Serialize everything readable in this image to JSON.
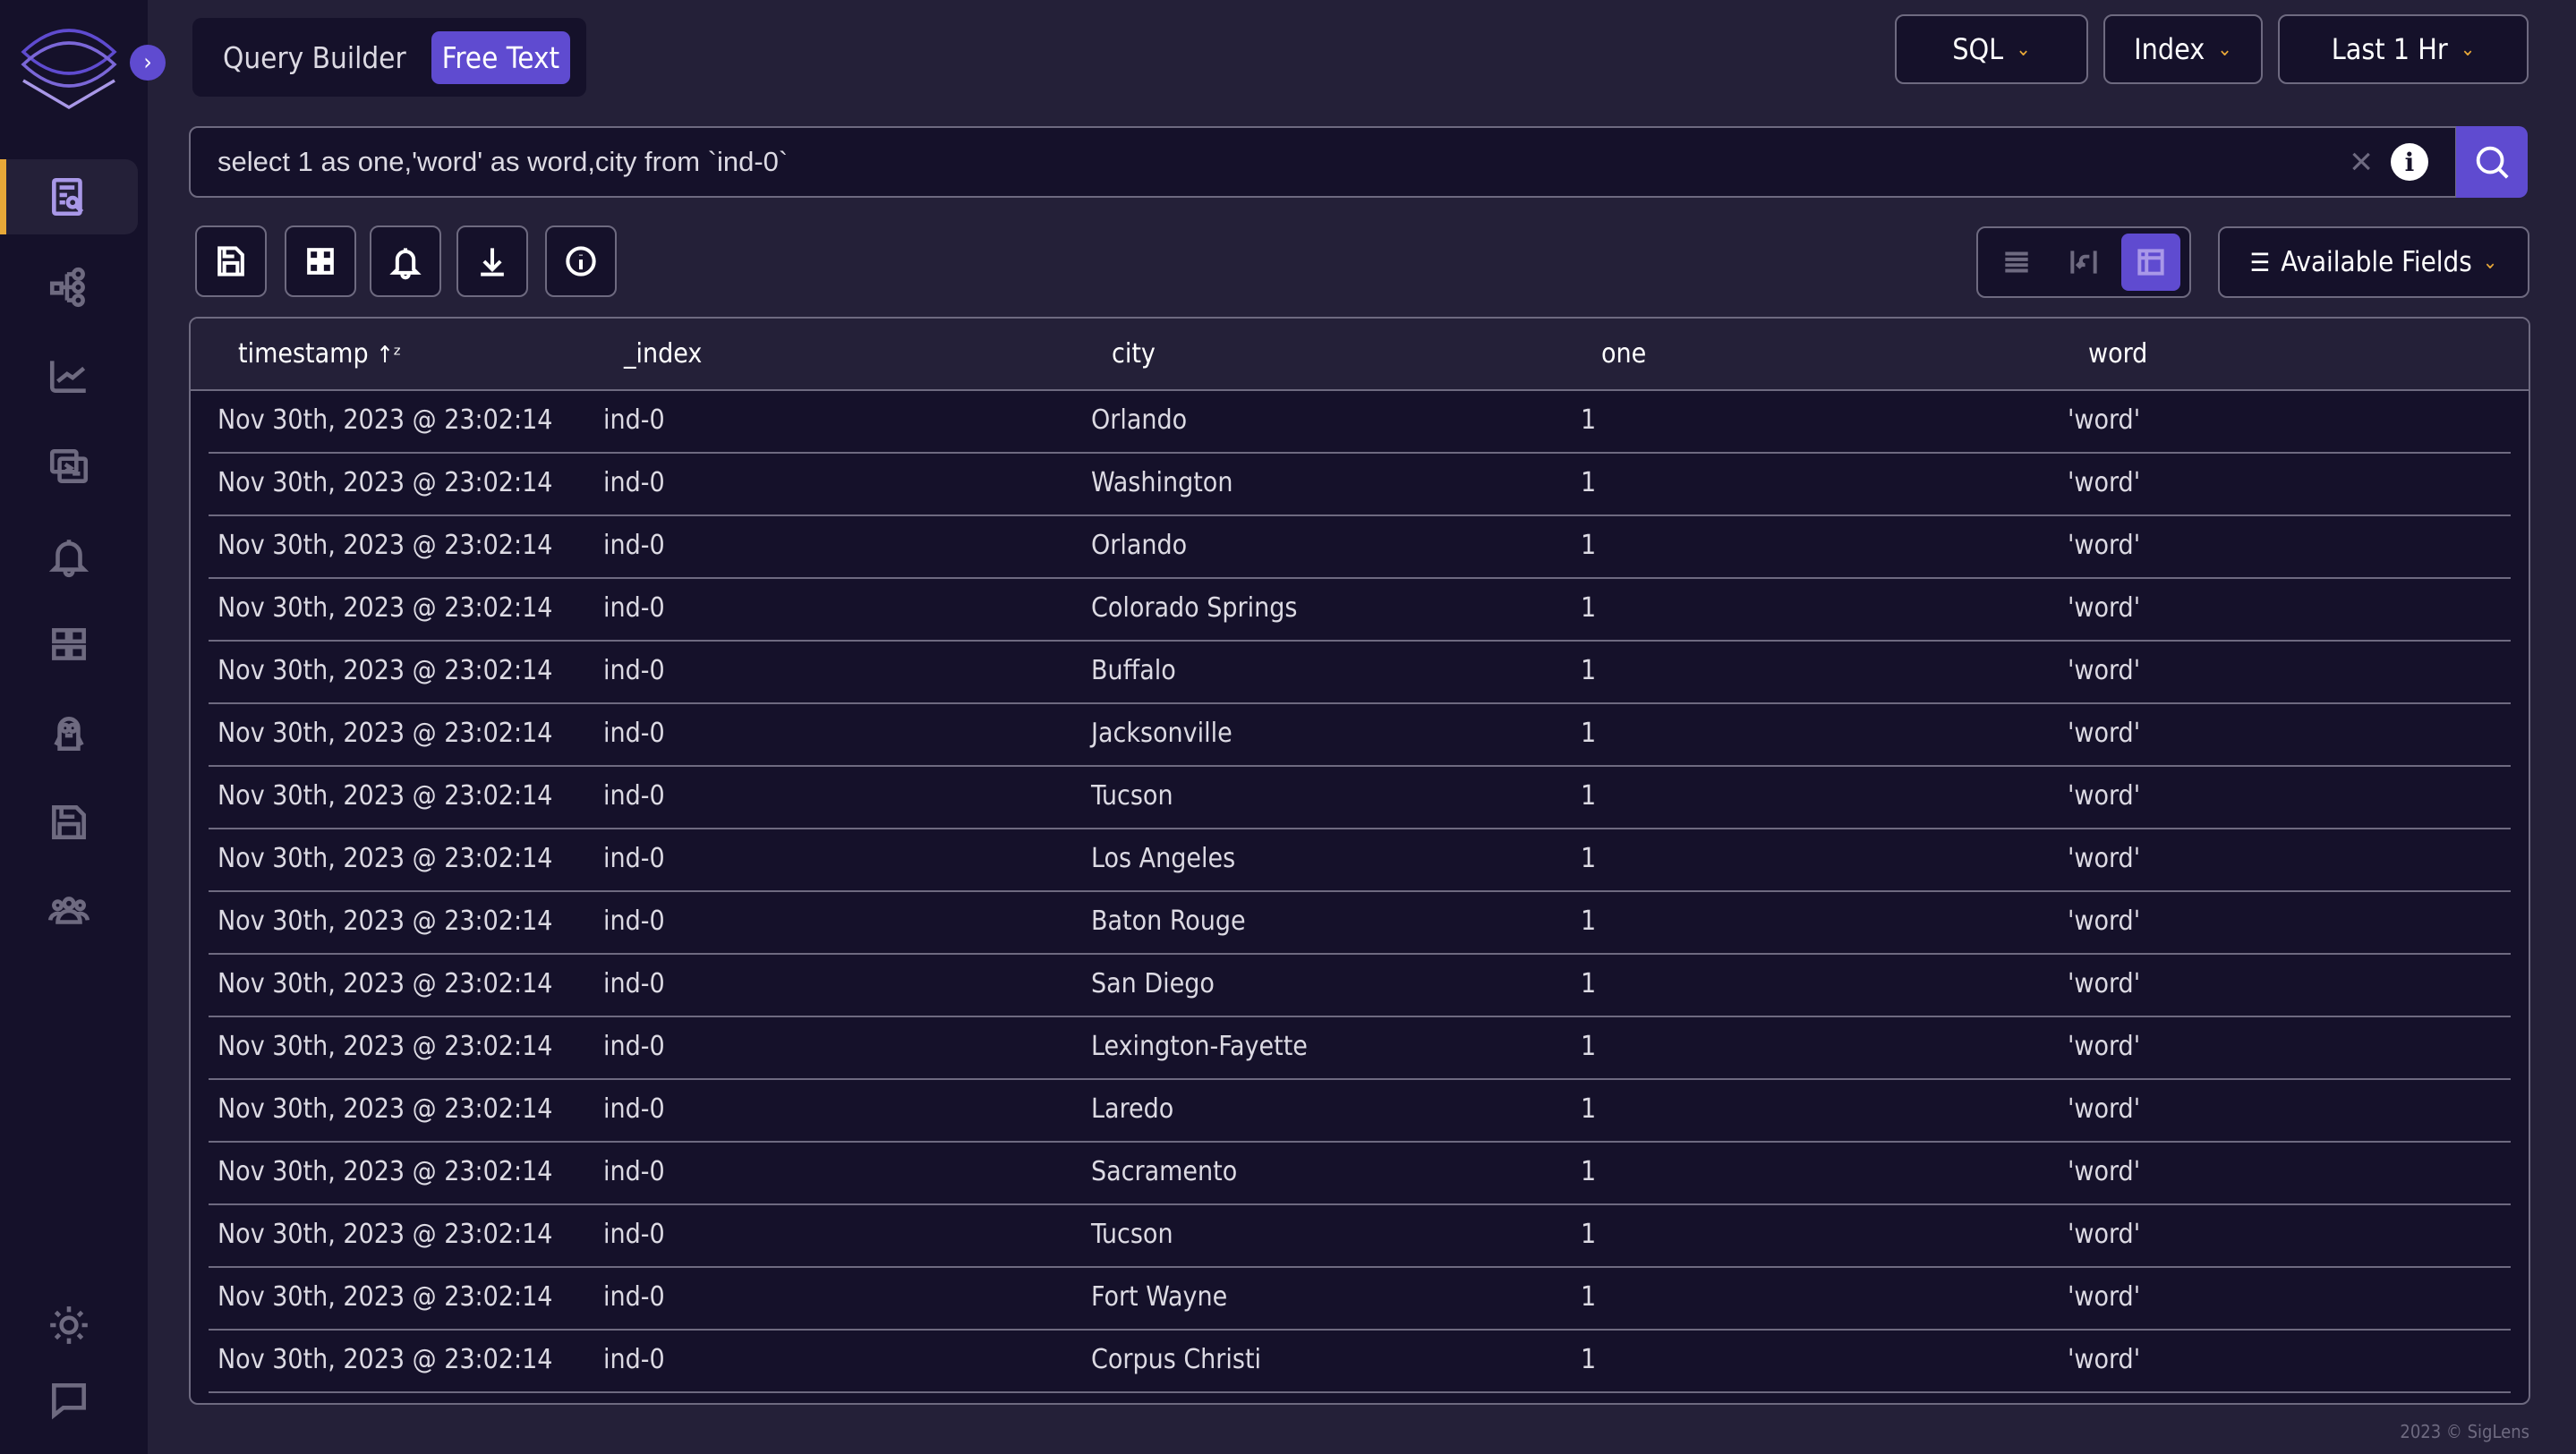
{
  "sidebar": {
    "items": [
      {
        "name": "logs-search",
        "icon": "log-search-icon",
        "active": true
      },
      {
        "name": "service-graph",
        "icon": "hierarchy-icon"
      },
      {
        "name": "metrics",
        "icon": "line-chart-icon"
      },
      {
        "name": "live-tail",
        "icon": "terminal-icon"
      },
      {
        "name": "alerts",
        "icon": "bell-icon"
      },
      {
        "name": "dashboards",
        "icon": "grid-icon"
      },
      {
        "name": "minion",
        "icon": "minion-icon"
      },
      {
        "name": "saved-queries",
        "icon": "save-icon"
      },
      {
        "name": "users",
        "icon": "users-icon"
      }
    ],
    "bottom": [
      "theme-sun-icon",
      "chat-icon"
    ]
  },
  "modes": {
    "query_builder": "Query Builder",
    "free_text": "Free Text",
    "active": "Free Text"
  },
  "dropdowns": {
    "language": "SQL",
    "index": "Index",
    "time": "Last 1 Hr"
  },
  "search": {
    "query": "select 1 as one,'word' as word,city from `ind-0`"
  },
  "toolbar": [
    "save-icon",
    "grid-icon",
    "bell-icon",
    "download-icon",
    "info-icon"
  ],
  "view_modes": {
    "options": [
      "single-line",
      "wrap",
      "table"
    ],
    "active": "table"
  },
  "available_fields": "Available Fields",
  "accent": "#5f4bd0",
  "highlight": "#e8a838",
  "table": {
    "headers": [
      "timestamp",
      "_index",
      "city",
      "one",
      "word"
    ],
    "rows": [
      [
        "Nov 30th, 2023 @ 23:02:14",
        "ind-0",
        "Orlando",
        "1",
        "'word'"
      ],
      [
        "Nov 30th, 2023 @ 23:02:14",
        "ind-0",
        "Washington",
        "1",
        "'word'"
      ],
      [
        "Nov 30th, 2023 @ 23:02:14",
        "ind-0",
        "Orlando",
        "1",
        "'word'"
      ],
      [
        "Nov 30th, 2023 @ 23:02:14",
        "ind-0",
        "Colorado Springs",
        "1",
        "'word'"
      ],
      [
        "Nov 30th, 2023 @ 23:02:14",
        "ind-0",
        "Buffalo",
        "1",
        "'word'"
      ],
      [
        "Nov 30th, 2023 @ 23:02:14",
        "ind-0",
        "Jacksonville",
        "1",
        "'word'"
      ],
      [
        "Nov 30th, 2023 @ 23:02:14",
        "ind-0",
        "Tucson",
        "1",
        "'word'"
      ],
      [
        "Nov 30th, 2023 @ 23:02:14",
        "ind-0",
        "Los Angeles",
        "1",
        "'word'"
      ],
      [
        "Nov 30th, 2023 @ 23:02:14",
        "ind-0",
        "Baton Rouge",
        "1",
        "'word'"
      ],
      [
        "Nov 30th, 2023 @ 23:02:14",
        "ind-0",
        "San Diego",
        "1",
        "'word'"
      ],
      [
        "Nov 30th, 2023 @ 23:02:14",
        "ind-0",
        "Lexington-Fayette",
        "1",
        "'word'"
      ],
      [
        "Nov 30th, 2023 @ 23:02:14",
        "ind-0",
        "Laredo",
        "1",
        "'word'"
      ],
      [
        "Nov 30th, 2023 @ 23:02:14",
        "ind-0",
        "Sacramento",
        "1",
        "'word'"
      ],
      [
        "Nov 30th, 2023 @ 23:02:14",
        "ind-0",
        "Tucson",
        "1",
        "'word'"
      ],
      [
        "Nov 30th, 2023 @ 23:02:14",
        "ind-0",
        "Fort Wayne",
        "1",
        "'word'"
      ],
      [
        "Nov 30th, 2023 @ 23:02:14",
        "ind-0",
        "Corpus Christi",
        "1",
        "'word'"
      ]
    ]
  },
  "footer": "2023 © SigLens"
}
